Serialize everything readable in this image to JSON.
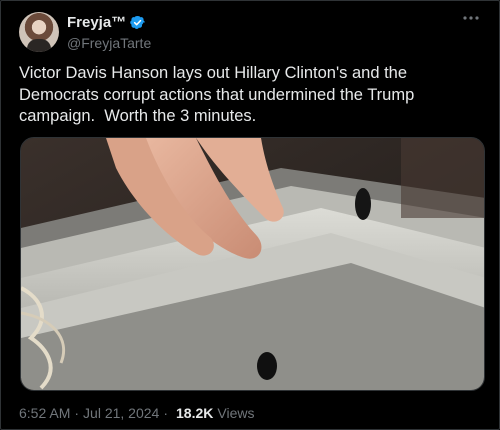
{
  "tweet": {
    "author": {
      "display_name": "Freyja™",
      "handle": "@FreyjaTarte",
      "verified_color": "#1d9bf0"
    },
    "more_icon": "more-dots-icon",
    "text": "Victor Davis Hanson lays out Hillary Clinton's and the Democrats corrupt actions that undermined the Trump campaign.  Worth the 3 minutes.",
    "meta": {
      "time": "6:52 AM",
      "date": "Jul 21, 2024",
      "separator": "·",
      "views_count": "18.2K",
      "views_label": "Views"
    }
  }
}
